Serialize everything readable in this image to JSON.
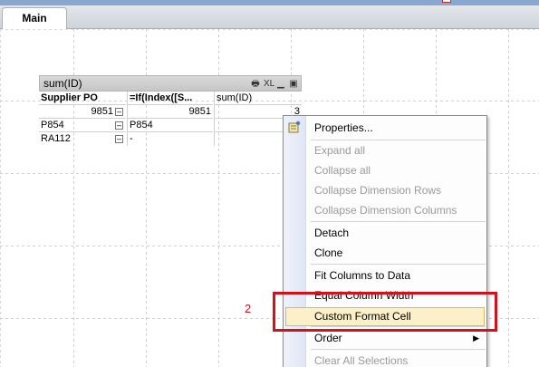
{
  "tabs": [
    {
      "label": "Main"
    }
  ],
  "chart_object": {
    "title": "sum(ID)",
    "caption_icons": [
      "print-icon",
      "xl-icon",
      "minimize-icon",
      "maximize-icon"
    ],
    "xl_label": "XL",
    "headers": [
      "Supplier PO",
      "=If(Index([S...",
      "sum(ID)"
    ],
    "rows": [
      {
        "c1": "9851",
        "c2": "9851",
        "c3": "3"
      },
      {
        "c1": "P854",
        "c2": "P854",
        "c3": ""
      },
      {
        "c1": "RA112",
        "c2": "-",
        "c3": ""
      }
    ]
  },
  "context_menu": {
    "items": [
      {
        "label": "Properties...",
        "enabled": true
      },
      {
        "label": "Expand all",
        "enabled": false
      },
      {
        "label": "Collapse all",
        "enabled": false
      },
      {
        "label": "Collapse Dimension Rows",
        "enabled": false
      },
      {
        "label": "Collapse Dimension Columns",
        "enabled": false
      },
      {
        "label": "Detach",
        "enabled": true
      },
      {
        "label": "Clone",
        "enabled": true
      },
      {
        "label": "Fit Columns to Data",
        "enabled": true
      },
      {
        "label": "Equal Column Width",
        "enabled": true
      },
      {
        "label": "Custom Format Cell",
        "enabled": true,
        "highlighted": true
      },
      {
        "label": "Order",
        "enabled": true,
        "has_submenu": true
      },
      {
        "label": "Clear All Selections",
        "enabled": false
      }
    ]
  },
  "annotation": {
    "step_number": "2",
    "color": "#d4111a"
  }
}
